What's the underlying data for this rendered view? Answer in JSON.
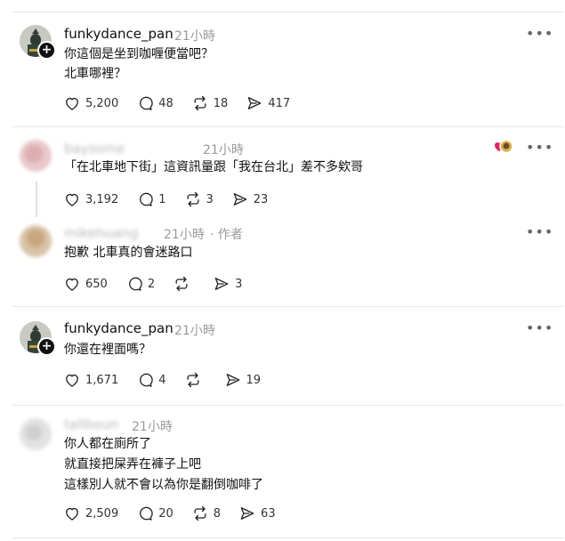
{
  "posts": [
    {
      "username": "funkydance_pan",
      "time": "21小時",
      "tag": "",
      "lines": [
        "你這個是坐到咖喱便當吧？",
        "北車哪裡？"
      ],
      "likes": "5,200",
      "comments": "48",
      "reposts": "18",
      "shares": "417",
      "avatar": "knight"
    },
    {
      "username": "baysome",
      "time": "21小時",
      "tag": "",
      "lines": [
        "「在北車地下街」這資訊量跟「我在台北」差不多欸哥"
      ],
      "likes": "3,192",
      "comments": "1",
      "reposts": "3",
      "shares": "23",
      "avatar": "blurred-pink"
    },
    {
      "username": "mikehuang",
      "time": "21小時",
      "tag": "· 作者",
      "lines": [
        "抱歉 北車真的會迷路口"
      ],
      "likes": "650",
      "comments": "2",
      "reposts": "",
      "shares": "3",
      "avatar": "blurred-tan"
    },
    {
      "username": "funkydance_pan",
      "time": "21小時",
      "tag": "",
      "lines": [
        "你還在裡面嗎？"
      ],
      "likes": "1,671",
      "comments": "4",
      "reposts": "",
      "shares": "19",
      "avatar": "knight"
    },
    {
      "username": "tallboun",
      "time": "21小時",
      "tag": "",
      "lines": [
        "你人都在廁所了",
        "就直接把屎弄在褲子上吧",
        "這樣別人就不會以為你是翻倒咖啡了"
      ],
      "likes": "2,509",
      "comments": "20",
      "reposts": "8",
      "shares": "63",
      "avatar": "blurred-gray"
    }
  ],
  "icons": {
    "more": "more-icon",
    "like": "heart-icon",
    "comment": "comment-icon",
    "repost": "repost-icon",
    "share": "share-icon",
    "follow": "plus-icon"
  },
  "colors": {
    "text": "#101010",
    "muted": "#999999",
    "divider": "#e5e5e5"
  }
}
